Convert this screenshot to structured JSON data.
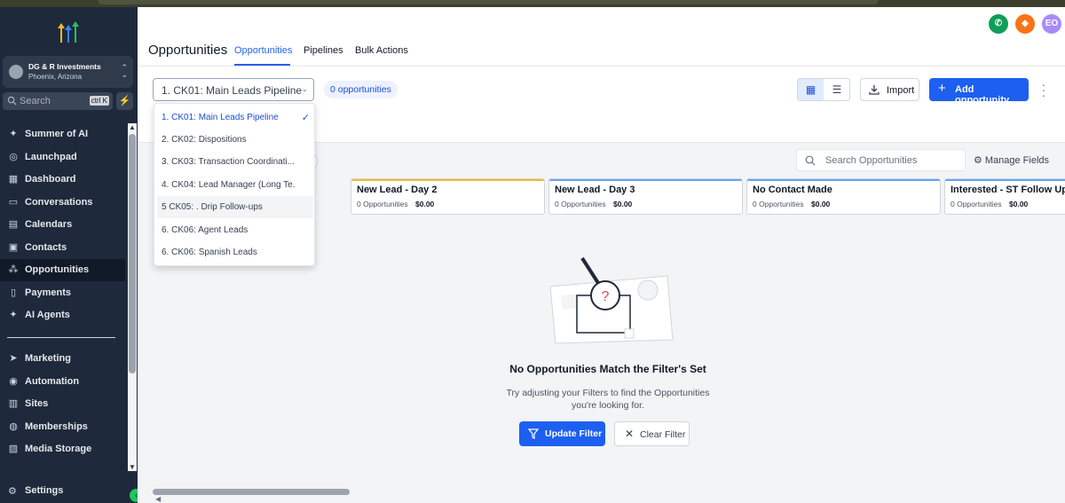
{
  "sidebar": {
    "account": {
      "name": "DG & R Investments",
      "location": "Phoenix, Arizona"
    },
    "search": {
      "placeholder": "Search",
      "shortcut": "ctrl K"
    },
    "items": [
      {
        "label": "Summer of AI",
        "icon": "sparkle-icon"
      },
      {
        "label": "Launchpad",
        "icon": "rocket-icon"
      },
      {
        "label": "Dashboard",
        "icon": "dashboard-icon"
      },
      {
        "label": "Conversations",
        "icon": "chat-icon"
      },
      {
        "label": "Calendars",
        "icon": "calendar-icon"
      },
      {
        "label": "Contacts",
        "icon": "contacts-icon"
      },
      {
        "label": "Opportunities",
        "icon": "opportunities-icon",
        "active": true
      },
      {
        "label": "Payments",
        "icon": "payments-icon"
      },
      {
        "label": "AI Agents",
        "icon": "sparkle-icon"
      },
      {
        "label": "Marketing",
        "icon": "send-icon"
      },
      {
        "label": "Automation",
        "icon": "automation-icon"
      },
      {
        "label": "Sites",
        "icon": "sites-icon"
      },
      {
        "label": "Memberships",
        "icon": "memberships-icon"
      },
      {
        "label": "Media Storage",
        "icon": "image-icon"
      }
    ],
    "settings": "Settings"
  },
  "header": {
    "title": "Opportunities",
    "tabs": [
      {
        "label": "Opportunities",
        "active": true
      },
      {
        "label": "Pipelines"
      },
      {
        "label": "Bulk Actions"
      }
    ],
    "avatar_initials": "EO",
    "colors": {
      "phone": "#0f9d58",
      "bell": "#f97316",
      "avatar": "#a78bfa"
    }
  },
  "toolbar": {
    "pipeline_selected": "1. CK01: Main Leads Pipeline",
    "count_label": "0 opportunities",
    "import_label": "Import",
    "add_label": "Add opportunity"
  },
  "filters": {
    "search_placeholder": "Search Opportunities",
    "manage_fields": "Manage Fields"
  },
  "dropdown": {
    "options": [
      {
        "label": "1. CK01: Main Leads Pipeline",
        "selected": true
      },
      {
        "label": "2. CK02: Dispositions"
      },
      {
        "label": "3. CK03: Transaction Coordinati..."
      },
      {
        "label": "4. CK04: Lead Manager (Long Te..."
      },
      {
        "label": "5 CK05: . Drip Follow-ups",
        "hovered": true
      },
      {
        "label": "6. CK06: Agent Leads"
      },
      {
        "label": "6. CK06: Spanish Leads"
      }
    ]
  },
  "stages": [
    {
      "title": "New Lead - Day 2",
      "count": "0 Opportunities",
      "value": "$0.00",
      "color": "#f5b82e"
    },
    {
      "title": "New Lead - Day 3",
      "count": "0 Opportunities",
      "value": "$0.00",
      "color": "#60a5fa"
    },
    {
      "title": "No Contact Made",
      "count": "0 Opportunities",
      "value": "$0.00",
      "color": "#60a5fa"
    },
    {
      "title": "Interested - ST Follow Up",
      "count": "0 Opportunities",
      "value": "$0.00",
      "color": "#60a5fa"
    }
  ],
  "empty_state": {
    "title": "No Opportunities Match the Filter's Set",
    "description": "Try adjusting your Filters to find the Opportunities you're looking for.",
    "update_label": "Update Filter",
    "clear_label": "Clear Filter"
  }
}
